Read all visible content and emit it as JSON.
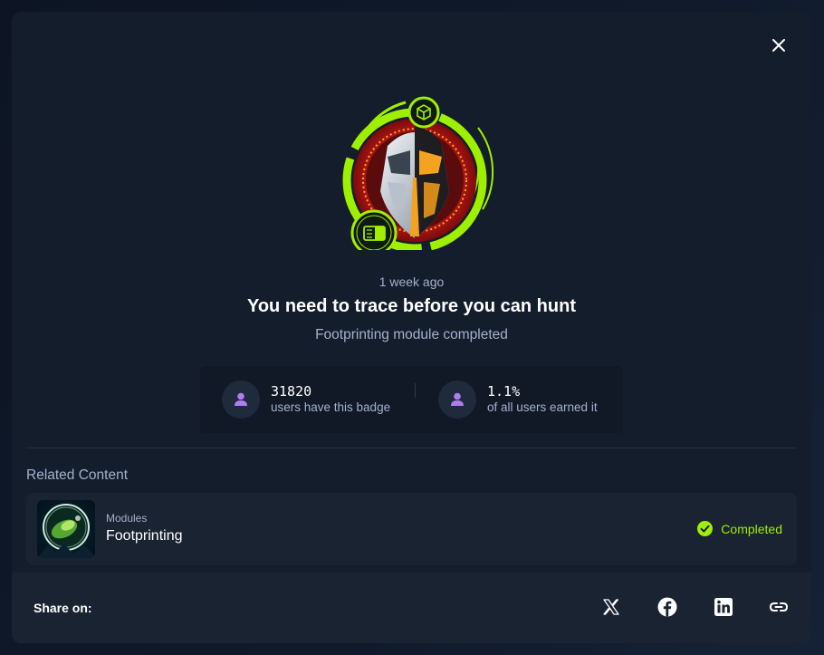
{
  "colors": {
    "accent": "#9fef00",
    "modal_bg": "#141d2b",
    "card_bg": "#1a2332",
    "muted_text": "#a4b1cd",
    "user_icon": "#9f6bf0"
  },
  "badge": {
    "time": "1 week ago",
    "title": "You need to trace before you can hunt",
    "subtitle": "Footprinting module completed"
  },
  "stats": [
    {
      "value": "31820",
      "label": "users have this badge",
      "icon": "user-icon"
    },
    {
      "value": "1.1%",
      "label": "of all users earned it",
      "icon": "user-icon"
    }
  ],
  "related": {
    "heading": "Related Content",
    "items": [
      {
        "category": "Modules",
        "name": "Footprinting",
        "status": "Completed"
      }
    ]
  },
  "share": {
    "label": "Share on:",
    "icons": [
      "x-twitter-icon",
      "facebook-icon",
      "linkedin-icon",
      "link-icon"
    ]
  }
}
